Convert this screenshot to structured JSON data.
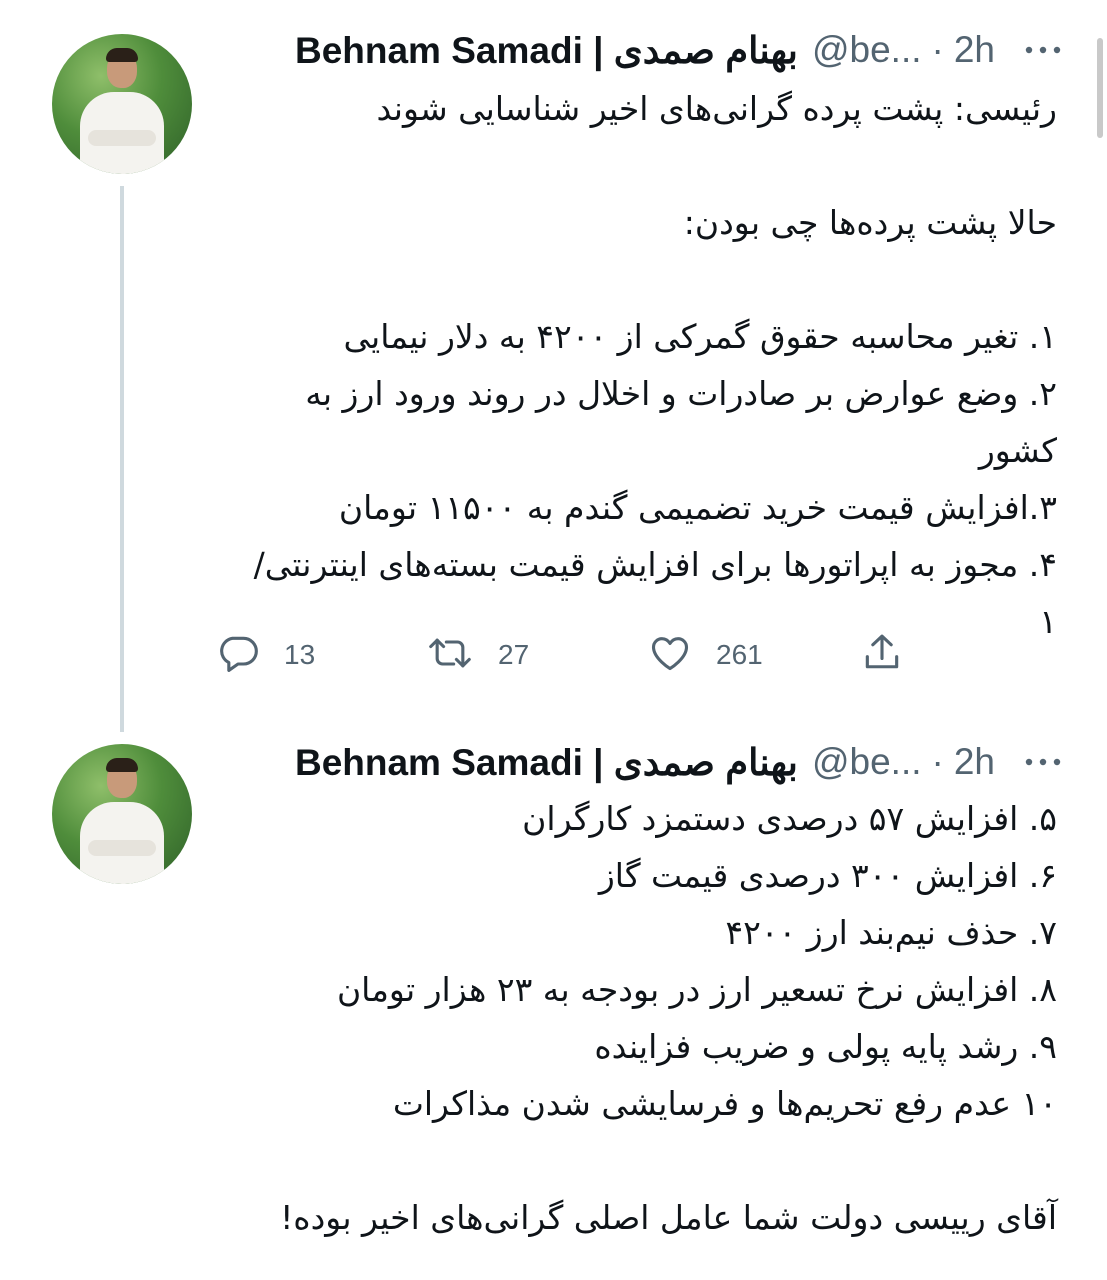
{
  "tweets": [
    {
      "author_name": "Behnam Samadi | بهنام صمدی",
      "handle": "@be...",
      "separator": "·",
      "time": "2h",
      "text": "رئیسی: پشت پرده گرانی‌های اخیر شناسایی شوند\n\nحالا پشت پرده‌ها چی بودن:\n\n۱. تغیر محاسبه حقوق گمرکی از ۴۲۰۰ به دلار نیمایی\n۲. وضع عوارض بر صادرات و اخلال در روند ورود ارز به کشور\n۳.افزایش قیمت خرید تضمیمی گندم به ۱۱۵۰۰ تومان\n۴. مجوز به اپراتورها برای افزایش قیمت بسته‌های اینترنتی/۱",
      "reply_count": "13",
      "retweet_count": "27",
      "like_count": "261"
    },
    {
      "author_name": "Behnam Samadi | بهنام صمدی",
      "handle": "@be...",
      "separator": "·",
      "time": "2h",
      "text": "۵. افزایش ۵۷ درصدی دستمزد کارگران\n۶. افزایش ۳۰۰ درصدی قیمت گاز\n۷. حذف نیم‌بند ارز ۴۲۰۰\n۸. افزایش نرخ تسعیر ارز در بودجه به ۲۳ هزار تومان\n۹. رشد پایه پولی و ضریب فزاینده\n۱۰ عدم رفع تحریم‌ها و فرسایشی شدن مذاکرات\n\nآقای رییسی دولت شما عامل اصلی گرانی‌های اخیر بوده!"
    }
  ],
  "icons": {
    "more": "more-horizontal-icon",
    "reply": "reply-icon",
    "retweet": "retweet-icon",
    "like": "heart-icon",
    "share": "share-icon"
  },
  "colors": {
    "text_primary": "#0f1419",
    "text_secondary": "#536471",
    "thread_line": "#cfd9de"
  }
}
